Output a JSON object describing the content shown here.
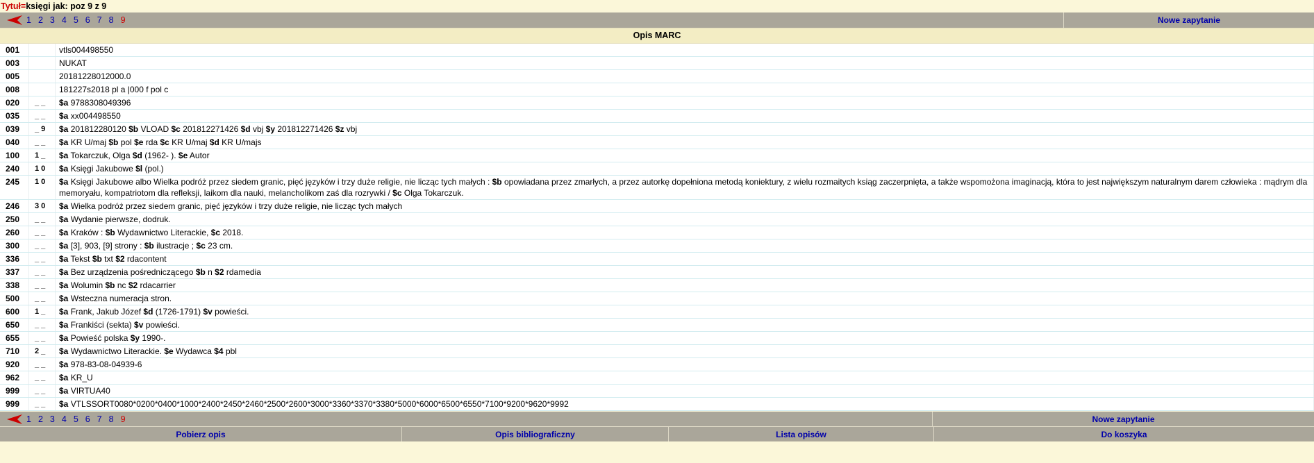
{
  "header": {
    "label": "Tytuł=",
    "query": "księgi jak: poz 9 z 9"
  },
  "nav": {
    "pages": [
      "1",
      "2",
      "3",
      "4",
      "5",
      "6",
      "7",
      "8",
      "9"
    ],
    "current": "9",
    "new_query": "Nowe zapytanie"
  },
  "section_title": "Opis MARC",
  "rows": [
    {
      "tag": "001",
      "ind": "",
      "text": "vtls004498550"
    },
    {
      "tag": "003",
      "ind": "",
      "text": "NUKAT"
    },
    {
      "tag": "005",
      "ind": "",
      "text": "20181228012000.0"
    },
    {
      "tag": "008",
      "ind": "",
      "text": "181227s2018 pl a |000 f pol c"
    },
    {
      "tag": "020",
      "ind": "_ _",
      "text": "$a 9788308049396"
    },
    {
      "tag": "035",
      "ind": "_ _",
      "text": "$a xx004498550"
    },
    {
      "tag": "039",
      "ind": "_ 9",
      "text": "$a 201812280120 $b VLOAD $c 201812271426 $d vbj $y 201812271426 $z vbj"
    },
    {
      "tag": "040",
      "ind": "_ _",
      "text": "$a KR U/maj $b pol $e rda $c KR U/maj $d KR U/majs"
    },
    {
      "tag": "100",
      "ind": "1 _",
      "text": "$a Tokarczuk, Olga $d (1962- ). $e Autor"
    },
    {
      "tag": "240",
      "ind": "1 0",
      "text": "$a Księgi Jakubowe $l (pol.)"
    },
    {
      "tag": "245",
      "ind": "1 0",
      "text": "$a Księgi Jakubowe albo Wielka podróż przez siedem granic, pięć języków i trzy duże religie, nie licząc tych małych : $b opowiadana przez zmarłych, a przez autorkę dopełniona metodą koniektury, z wielu rozmaitych ksiąg zaczerpnięta, a także wspomożona imaginacją, która to jest największym naturalnym darem człowieka : mądrym dla memoryału, kompatriotom dla refleksji, laikom dla nauki, melancholikom zaś dla rozrywki / $c Olga Tokarczuk."
    },
    {
      "tag": "246",
      "ind": "3 0",
      "text": "$a Wielka podróż przez siedem granic, pięć języków i trzy duże religie, nie licząc tych małych"
    },
    {
      "tag": "250",
      "ind": "_ _",
      "text": "$a Wydanie pierwsze, dodruk."
    },
    {
      "tag": "260",
      "ind": "_ _",
      "text": "$a Kraków : $b Wydawnictwo Literackie, $c 2018."
    },
    {
      "tag": "300",
      "ind": "_ _",
      "text": "$a [3], 903, [9] strony : $b ilustracje ; $c 23 cm."
    },
    {
      "tag": "336",
      "ind": "_ _",
      "text": "$a Tekst $b txt $2 rdacontent"
    },
    {
      "tag": "337",
      "ind": "_ _",
      "text": "$a Bez urządzenia pośredniczącego $b n $2 rdamedia"
    },
    {
      "tag": "338",
      "ind": "_ _",
      "text": "$a Wolumin $b nc $2 rdacarrier"
    },
    {
      "tag": "500",
      "ind": "_ _",
      "text": "$a Wsteczna numeracja stron."
    },
    {
      "tag": "600",
      "ind": "1 _",
      "text": "$a Frank, Jakub Józef $d (1726-1791) $v powieści."
    },
    {
      "tag": "650",
      "ind": "_ _",
      "text": "$a Frankiści (sekta) $v powieści."
    },
    {
      "tag": "655",
      "ind": "_ _",
      "text": "$a Powieść polska $y 1990-."
    },
    {
      "tag": "710",
      "ind": "2 _",
      "text": "$a Wydawnictwo Literackie. $e Wydawca $4 pbl"
    },
    {
      "tag": "920",
      "ind": "_ _",
      "text": "$a 978-83-08-04939-6"
    },
    {
      "tag": "962",
      "ind": "_ _",
      "text": "$a KR_U"
    },
    {
      "tag": "999",
      "ind": "_ _",
      "text": "$a VIRTUA40"
    },
    {
      "tag": "999",
      "ind": "_ _",
      "text": "$a VTLSSORT0080*0200*0400*1000*2400*2450*2460*2500*2600*3000*3360*3370*3380*5000*6000*6500*6550*7100*9200*9620*9992"
    }
  ],
  "bottom": {
    "get_record": "Pobierz opis",
    "bib_record": "Opis bibliograficzny",
    "record_list": "Lista opisów",
    "to_cart": "Do koszyka"
  },
  "colors": {
    "accent_red": "#cc0000",
    "link_blue": "#0000aa",
    "bar": "#aaa69a",
    "page_bg": "#fbf7d9"
  }
}
